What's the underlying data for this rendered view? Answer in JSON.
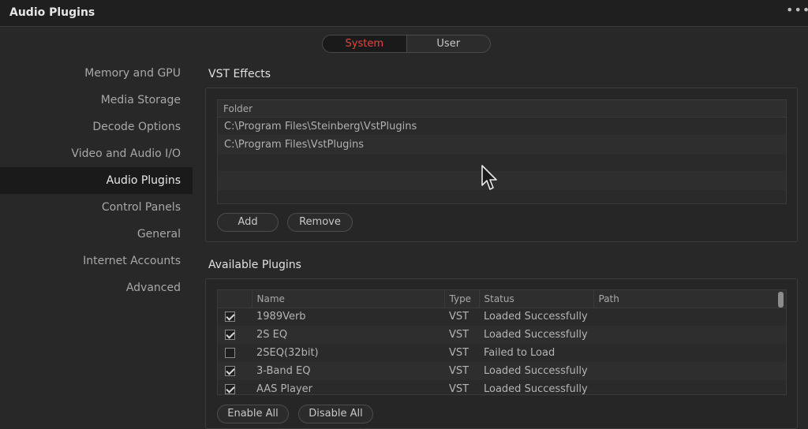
{
  "window": {
    "title": "Audio Plugins",
    "more_label": "•••"
  },
  "tabs": [
    {
      "label": "System",
      "active": true
    },
    {
      "label": "User",
      "active": false
    }
  ],
  "sidebar": {
    "items": [
      {
        "label": "Memory and GPU",
        "active": false
      },
      {
        "label": "Media Storage",
        "active": false
      },
      {
        "label": "Decode Options",
        "active": false
      },
      {
        "label": "Video and Audio I/O",
        "active": false
      },
      {
        "label": "Audio Plugins",
        "active": true
      },
      {
        "label": "Control Panels",
        "active": false
      },
      {
        "label": "General",
        "active": false
      },
      {
        "label": "Internet Accounts",
        "active": false
      },
      {
        "label": "Advanced",
        "active": false
      }
    ]
  },
  "vst_effects": {
    "title": "VST Effects",
    "column": "Folder",
    "folders": [
      "C:\\Program Files\\Steinberg\\VstPlugins",
      "C:\\Program Files\\VstPlugins"
    ],
    "add_label": "Add",
    "remove_label": "Remove"
  },
  "available_plugins": {
    "title": "Available Plugins",
    "columns": {
      "name": "Name",
      "type": "Type",
      "status": "Status",
      "path": "Path"
    },
    "rows": [
      {
        "checked": true,
        "name": "1989Verb",
        "type": "VST",
        "status": "Loaded Successfully",
        "path": ""
      },
      {
        "checked": true,
        "name": "2S EQ",
        "type": "VST",
        "status": "Loaded Successfully",
        "path": ""
      },
      {
        "checked": false,
        "name": "2SEQ(32bit)",
        "type": "VST",
        "status": "Failed to Load",
        "path": ""
      },
      {
        "checked": true,
        "name": "3-Band EQ",
        "type": "VST",
        "status": "Loaded Successfully",
        "path": ""
      },
      {
        "checked": true,
        "name": "AAS Player",
        "type": "VST",
        "status": "Loaded Successfully",
        "path": ""
      }
    ],
    "enable_all_label": "Enable All",
    "disable_all_label": "Disable All"
  },
  "colors": {
    "accent": "#e0473f",
    "background": "#282828",
    "active_bg": "#1a1a1a"
  }
}
